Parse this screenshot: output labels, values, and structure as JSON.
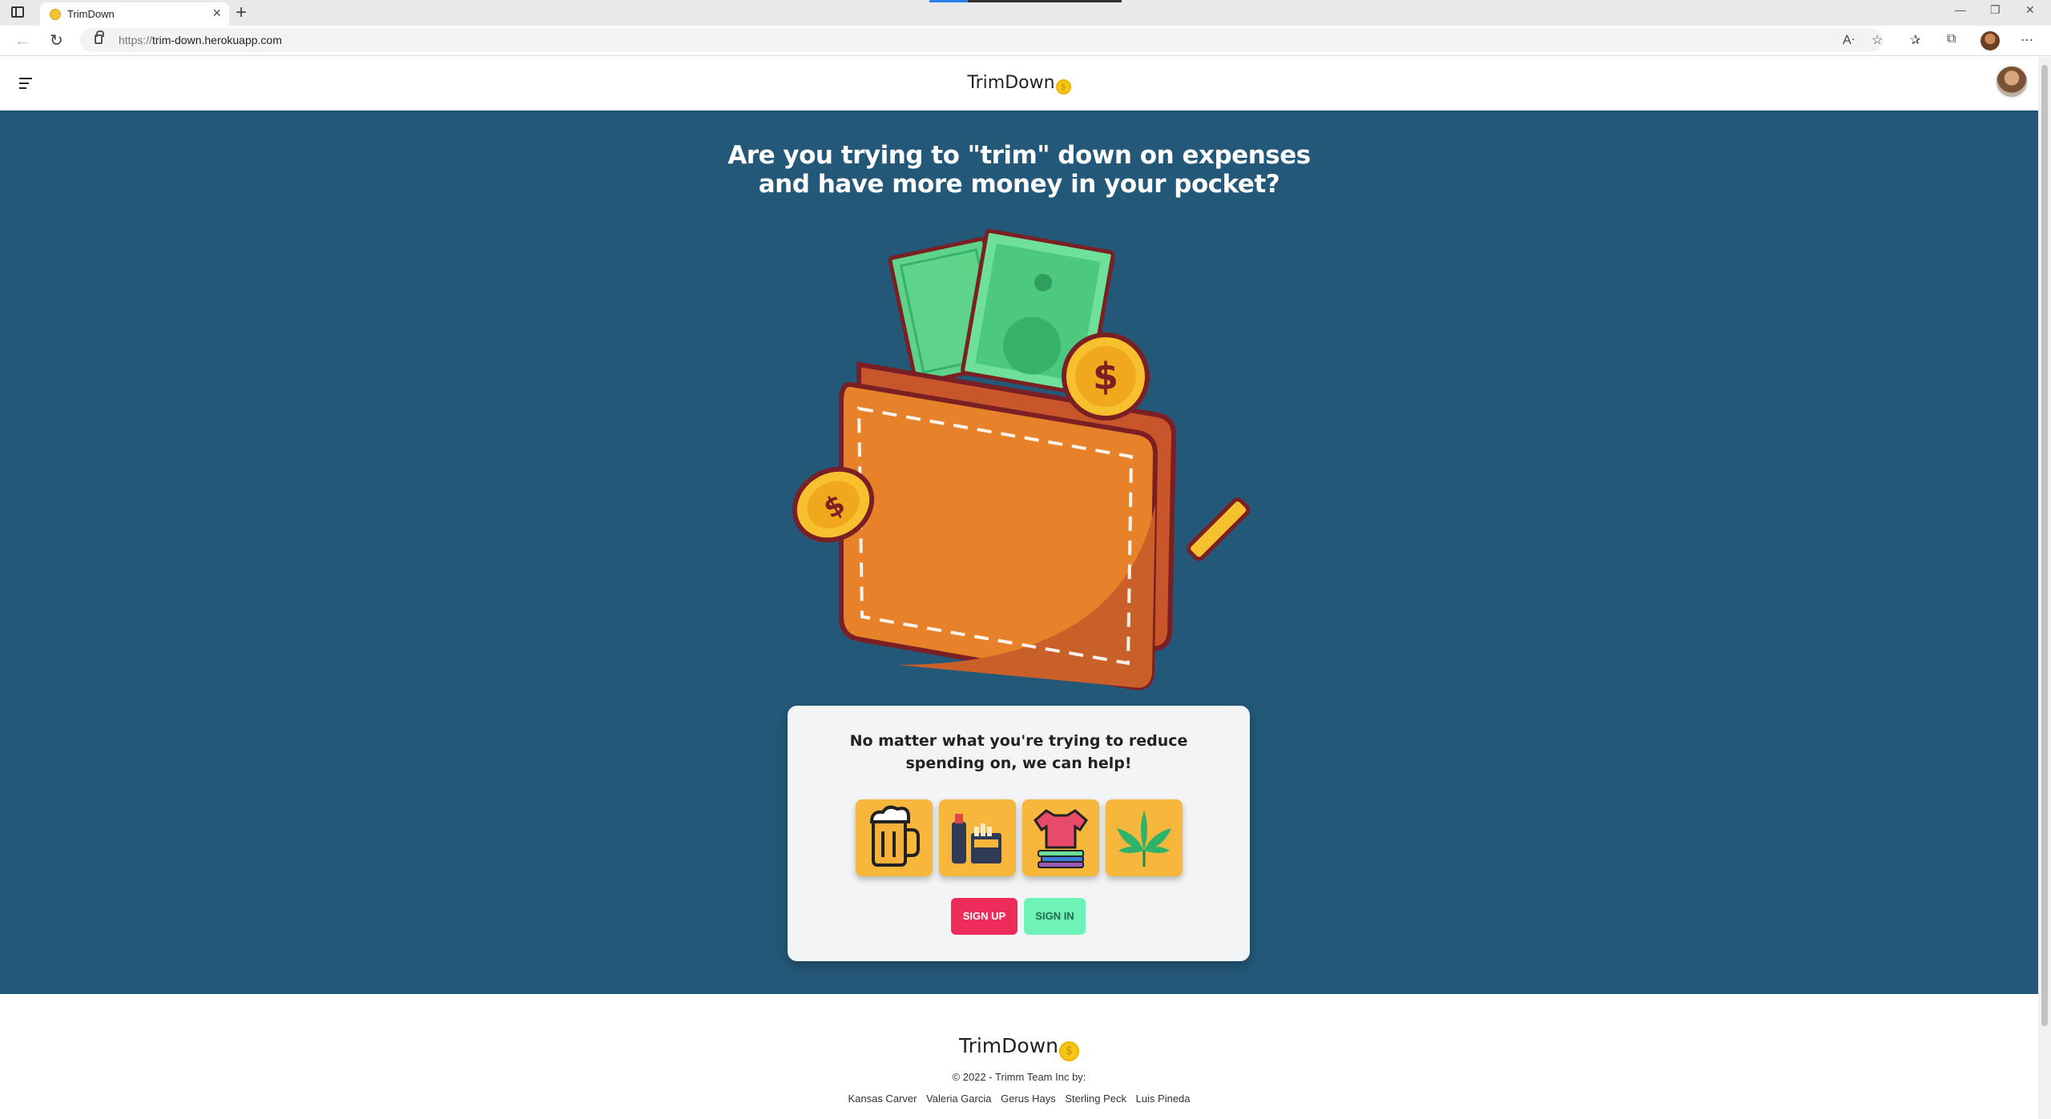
{
  "browser": {
    "tab_title": "TrimDown",
    "new_tab_icon": "+",
    "url_scheme": "https://",
    "url_host": "trim-down.herokuapp.com",
    "icons": [
      "sidebar-toggle-icon",
      "back-icon",
      "refresh-icon",
      "lock-icon",
      "read-aloud-icon",
      "add-favorite-icon",
      "favorites-icon",
      "collections-icon",
      "more-icon"
    ]
  },
  "header": {
    "brand": "TrimDown",
    "coin_symbol": "$"
  },
  "hero": {
    "title_line1": "Are you trying to \"trim\" down on expenses",
    "title_line2": "and have more money in your pocket?"
  },
  "card": {
    "text": "No matter what you're trying to reduce spending on, we can help!",
    "categories": [
      "beer-icon",
      "cigarettes-lighter-icon",
      "clothing-icon",
      "cannabis-leaf-icon"
    ],
    "signup_label": "SIGN UP",
    "signin_label": "SIGN IN"
  },
  "footer": {
    "brand": "TrimDown",
    "copyright": "© 2022 - Trimm Team Inc by:",
    "credits": [
      "Kansas Carver",
      "Valeria Garcia",
      "Gerus Hays",
      "Sterling Peck",
      "Luis Pineda"
    ]
  },
  "colors": {
    "hero_bg": "#245879",
    "signup": "#ee2c5b",
    "signin": "#6ff2b7",
    "tile": "#f6b73c",
    "coin": "#f5c518"
  }
}
